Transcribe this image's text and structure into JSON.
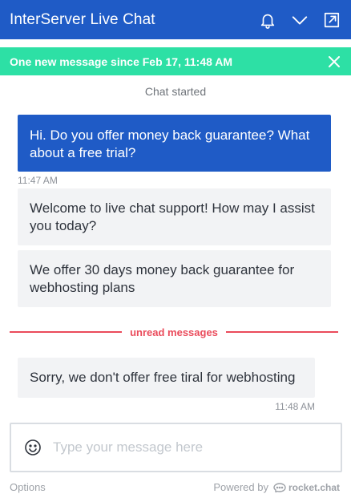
{
  "header": {
    "title": "InterServer Live Chat",
    "icons": [
      "bell-icon",
      "chevron-down-icon",
      "popout-icon"
    ]
  },
  "banner": {
    "text": "One new message since Feb 17, 11:48 AM"
  },
  "chat": {
    "started_label": "Chat started",
    "messages": [
      {
        "direction": "outgoing",
        "text": "Hi. Do you offer money back guarantee? What about a free trial?"
      },
      {
        "direction": "incoming",
        "text": "Welcome to live chat support! How may I assist you today?"
      },
      {
        "direction": "incoming",
        "text": "We offer 30 days money back guarantee for webhosting plans"
      },
      {
        "direction": "incoming",
        "text": "Sorry, we don't offer free tiral for webhosting"
      }
    ],
    "timestamps": [
      "11:47 AM",
      "11:48 AM"
    ],
    "unread_label": "unread messages"
  },
  "composer": {
    "placeholder": "Type your message here"
  },
  "footer": {
    "options_label": "Options",
    "powered_by": "Powered by",
    "brand": "rocket.chat"
  },
  "colors": {
    "header_bg": "#1f5bc6",
    "banner_bg": "#2de0a5",
    "unread": "#ea4b5b"
  }
}
